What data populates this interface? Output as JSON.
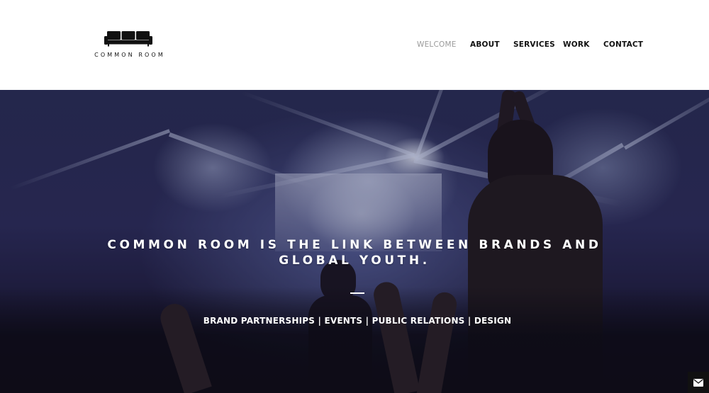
{
  "brand": {
    "name": "COMMON ROOM",
    "logo_icon": "sofa-icon"
  },
  "nav": {
    "items": [
      {
        "label": "WELCOME",
        "active": true
      },
      {
        "label": "ABOUT",
        "active": false
      },
      {
        "label": "SERVICES",
        "active": false
      },
      {
        "label": "WORK",
        "active": false
      },
      {
        "label": "CONTACT",
        "active": false
      }
    ]
  },
  "hero": {
    "title": "COMMON ROOM IS THE LINK BETWEEN BRANDS AND GLOBAL YOUTH.",
    "subtitle": "BRAND PARTNERSHIPS | EVENTS | PUBLIC RELATIONS | DESIGN",
    "background": "concert-crowd-image"
  },
  "contact_button": {
    "icon": "envelope-icon"
  },
  "colors": {
    "header_bg": "#ffffff",
    "nav_text": "#111111",
    "nav_active": "#9a9a9a",
    "hero_text": "#ffffff",
    "mail_btn_bg": "#111111"
  }
}
